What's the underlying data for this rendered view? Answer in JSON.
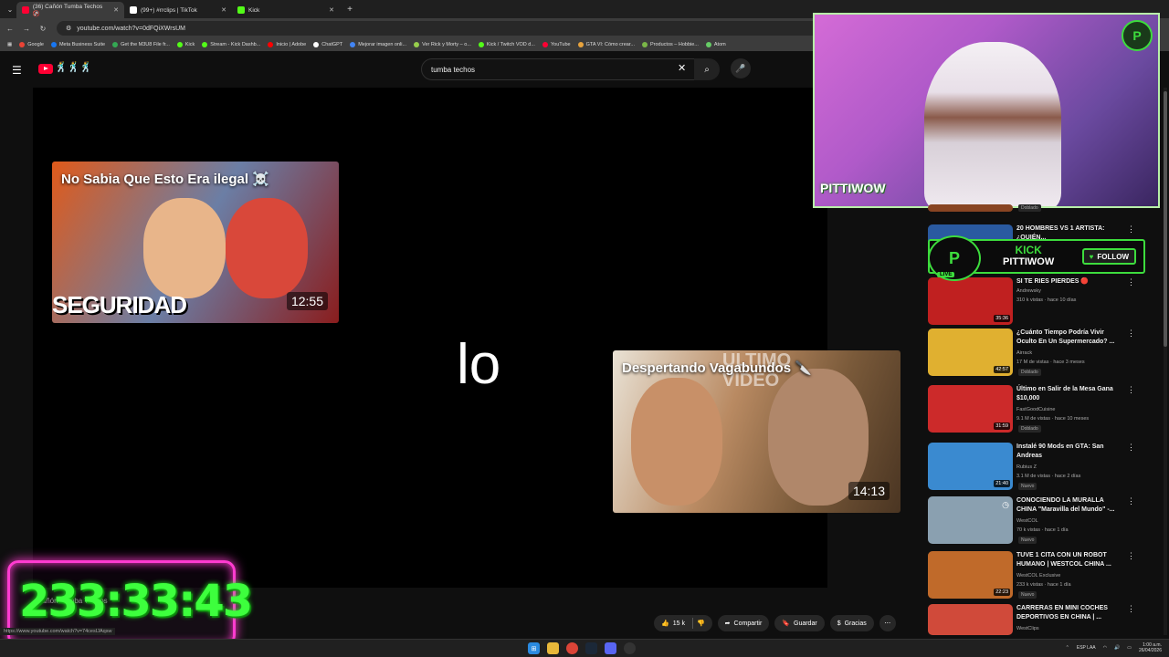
{
  "browser": {
    "tabs": [
      {
        "label": "(36) Cañón Tumba Techos 🚱",
        "color": "#ff0033"
      },
      {
        "label": "(99+) #rrclips | TikTok",
        "color": "#222222"
      },
      {
        "label": "Kick",
        "color": "#53fc18"
      }
    ],
    "url": "youtube.com/watch?v=0dFQiXWrsUM",
    "bookmarks": [
      "Google",
      "Meta Business Suite",
      "Get the M3U8 File fr...",
      "Kick",
      "Stream - Kick Dashb...",
      "Inicio | Adobe",
      "ChatGPT",
      "Mejorar imagen onli...",
      "Ver Rick y Morty – o...",
      "Kick / Twitch VOD d...",
      "YouTube",
      "GTA VI: Cómo crear...",
      "Productos – Hobbie...",
      "Atom"
    ]
  },
  "youtube": {
    "search_value": "tumba techos",
    "doodle": "🕺🕺🕺"
  },
  "player": {
    "center_text": "lo",
    "endcards": [
      {
        "title": "No Sabia Que Esto Era ilegal ☠️",
        "overlay": "SEGURIDAD",
        "duration": "12:55"
      },
      {
        "title": "Despertando Vagabundos 🔪",
        "overlay": "ULTIMO VIDEO",
        "duration": "14:13"
      }
    ]
  },
  "webcam": {
    "overlay_name": "PITTIWOW",
    "logo_letter": "P"
  },
  "kick_banner": {
    "brand": "KICK",
    "channel": "PITTIWOW",
    "follow": "FOLLOW",
    "live": "LIVE"
  },
  "timer": {
    "text": "233:33:43"
  },
  "sidebar": [
    {
      "title": "",
      "channel": "",
      "meta": "",
      "badge": "Doblado",
      "duration": "",
      "color": "#884422"
    },
    {
      "title": "20 HOMBRES VS 1 ARTISTA: ¿QUIÉN...",
      "channel": "",
      "meta": "",
      "badge": "",
      "duration": "",
      "color": "#2a5aa0"
    },
    {
      "title": "SI TE RIES PIERDES 🔴",
      "channel": "Andrewsky",
      "meta": "310 k vistas · hace 10 días",
      "badge": "",
      "duration": "35:36",
      "color": "#c02020"
    },
    {
      "title": "¿Cuánto Tiempo Podría Vivir Oculto En Un Supermercado? ...",
      "channel": "Airrack",
      "meta": "17 M de vistas · hace 3 meses",
      "badge": "Doblado",
      "duration": "42:57",
      "color": "#e0b030"
    },
    {
      "title": "Último en Salir de la Mesa Gana $10,000",
      "channel": "FastGoodCuisine",
      "meta": "9.1 M de vistas · hace 10 meses",
      "badge": "Doblado",
      "duration": "31:59",
      "color": "#cc2a2a"
    },
    {
      "title": "Instalé 90 Mods en GTA: San Andreas",
      "channel": "Rubius Z",
      "meta": "3.1 M de vistas · hace 2 días",
      "badge": "Nuevo",
      "duration": "21:40",
      "color": "#3a8ad0"
    },
    {
      "title": "CONOCIENDO LA MURALLA CHINA \"Maravilla del Mundo\" -...",
      "channel": "WestCOL",
      "meta": "70 k vistas · hace 1 día",
      "badge": "Nuevo",
      "duration": "",
      "color": "#8aa0b0"
    },
    {
      "title": "TUVE 1 CITA CON UN ROBOT HUMANO | WESTCOL CHINA ...",
      "channel": "WestCOL Exclusive",
      "meta": "233 k vistas · hace 1 día",
      "badge": "Nuevo",
      "duration": "22:23",
      "color": "#c06a2a"
    },
    {
      "title": "CARRERAS EN MINI COCHES DEPORTIVOS EN CHINA | ...",
      "channel": "WestClips",
      "meta": "",
      "badge": "",
      "duration": "",
      "color": "#d04a3a"
    }
  ],
  "actions": {
    "likes": "15 k",
    "share": "Compartir",
    "save": "Guardar",
    "thanks": "Gracias"
  },
  "below_player": {
    "channel_snip": "Cañón Tumba Techos"
  },
  "status_url": "https://www.youtube.com/watch?v=74cesIJAqsw",
  "tray": {
    "lang": "ESP LAA",
    "time": "1:00 a.m.",
    "date": "26/04/2026"
  }
}
